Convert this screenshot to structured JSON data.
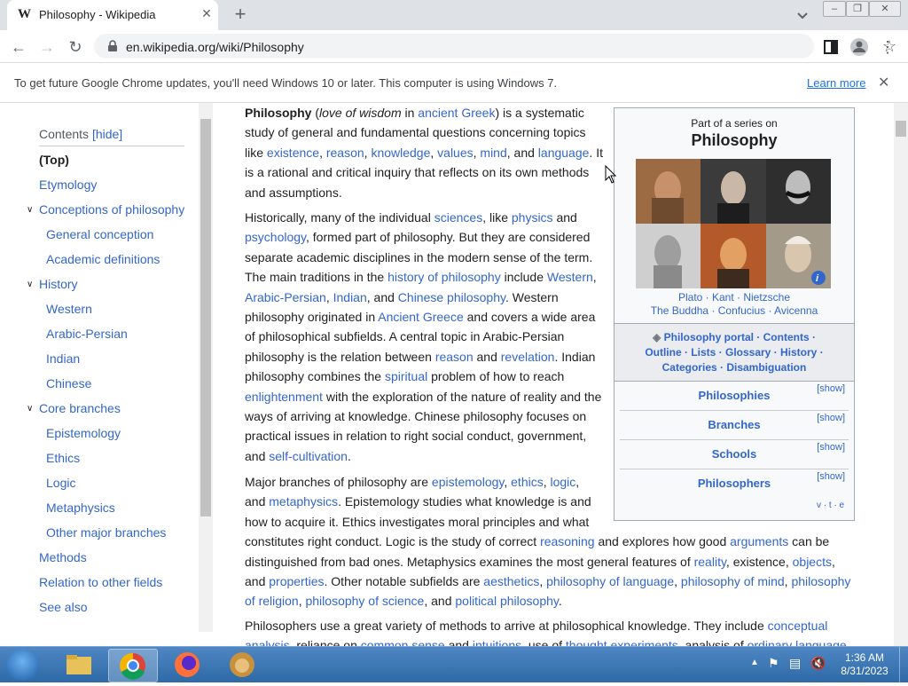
{
  "browser": {
    "tab_title": "Philosophy - Wikipedia",
    "tab_favicon": "W",
    "url": "en.wikipedia.org/wiki/Philosophy",
    "infobar_text": "To get future Google Chrome updates, you'll need Windows 10 or later. This computer is using Windows 7.",
    "infobar_link": "Learn more"
  },
  "toc": {
    "heading": "Contents",
    "hide": "[hide]",
    "items": [
      {
        "label": "(Top)"
      },
      {
        "label": "Etymology"
      },
      {
        "label": "Conceptions of philosophy"
      },
      {
        "label": "General conception"
      },
      {
        "label": "Academic definitions"
      },
      {
        "label": "History"
      },
      {
        "label": "Western"
      },
      {
        "label": "Arabic-Persian"
      },
      {
        "label": "Indian"
      },
      {
        "label": "Chinese"
      },
      {
        "label": "Core branches"
      },
      {
        "label": "Epistemology"
      },
      {
        "label": "Ethics"
      },
      {
        "label": "Logic"
      },
      {
        "label": "Metaphysics"
      },
      {
        "label": "Other major branches"
      },
      {
        "label": "Methods"
      },
      {
        "label": "Relation to other fields"
      },
      {
        "label": "See also"
      }
    ]
  },
  "infobox": {
    "sup": "Part of a series on",
    "title": "Philosophy",
    "caption1": "Plato · Kant · Nietzsche",
    "caption2": "The Buddha · Confucius · Avicenna",
    "nav1": "Philosophy portal · Contents ·",
    "nav2": "Outline · Lists · Glossary · History ·",
    "nav3": "Categories · Disambiguation",
    "sections": [
      {
        "title": "Philosophies",
        "show": "[show]"
      },
      {
        "title": "Branches",
        "show": "[show]"
      },
      {
        "title": "Schools",
        "show": "[show]"
      },
      {
        "title": "Philosophers",
        "show": "[show]"
      }
    ],
    "vte": "v · t · e"
  },
  "taskbar": {
    "time": "1:36 AM",
    "date": "8/31/2023"
  }
}
